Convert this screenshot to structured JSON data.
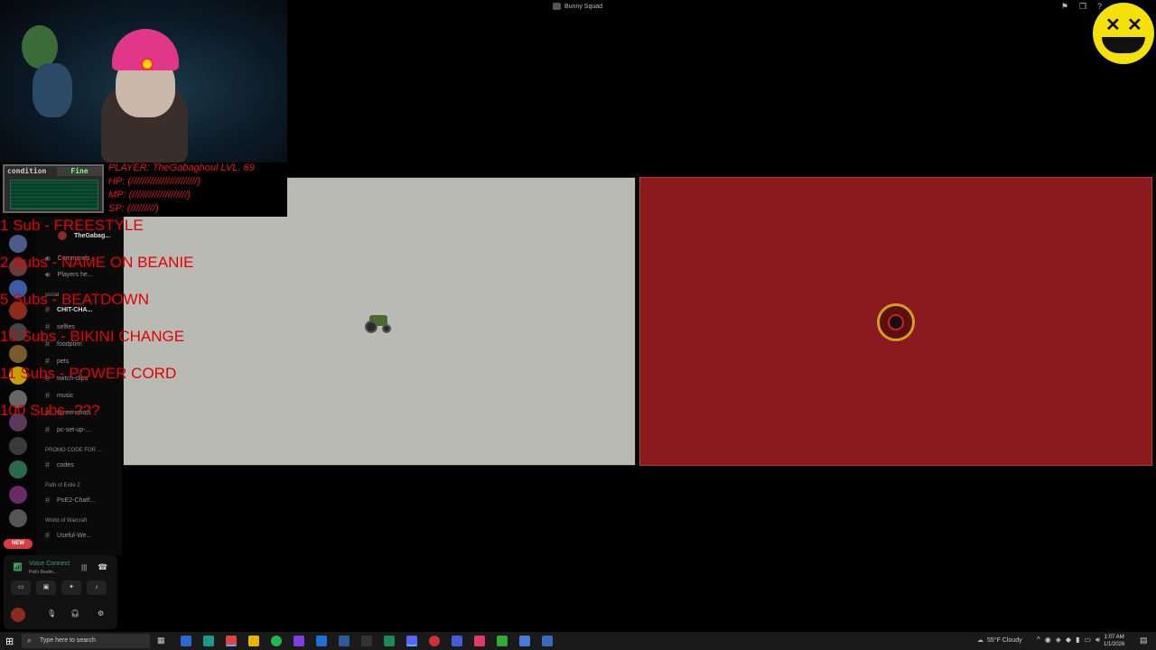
{
  "window": {
    "title": "Bunny Squad"
  },
  "title_icons": [
    "flag-icon",
    "restore-icon",
    "help-icon"
  ],
  "overlay": {
    "condition_label": "condition",
    "condition_value": "Fine",
    "player": "PLAYER: TheGabaghoul LVL. 69",
    "hp": "HP:    (////////////////////////)",
    "mp": "MP:    (////////////////////)",
    "sp": "SP: (/////////)"
  },
  "sub_goals": [
    "1 Sub - FREESTYLE",
    "2 Subs - NAME ON BEANIE",
    "5 Subs - BEATDOWN",
    "10 Subs - BIKINI CHANGE",
    "11 Subs - POWER CORD",
    "100 Subs -???"
  ],
  "channels": {
    "user_in_voice": "TheGabag...",
    "items": [
      {
        "label": "Commands",
        "icon": "speaker-icon"
      },
      {
        "label": "Players he...",
        "icon": "speaker-icon"
      },
      {
        "label": "CHIT-CHA...",
        "icon": "hash-icon"
      },
      {
        "label": "selfies",
        "icon": "hash-icon"
      },
      {
        "label": "foodporn",
        "icon": "hash-icon"
      },
      {
        "label": "pets",
        "icon": "hash-icon"
      },
      {
        "label": "twitch-clips",
        "icon": "hash-icon"
      },
      {
        "label": "music",
        "icon": "hash-icon"
      },
      {
        "label": "screenshots",
        "icon": "hash-icon"
      },
      {
        "label": "pc-set-up-...",
        "icon": "hash-icon"
      },
      {
        "label": "codes",
        "icon": "hash-icon"
      },
      {
        "label": "PoE2-Chatf...",
        "icon": "hash-icon"
      },
      {
        "label": "Useful-We...",
        "icon": "hash-icon"
      }
    ],
    "categories": {
      "social": "social",
      "promo": "PROMO CODE FOR ...",
      "poe": "Path of Exile 2",
      "wow": "World of Warcraft"
    }
  },
  "server_rail": {
    "new_badge": "NEW"
  },
  "user_panel": {
    "voice_title": "Voice Connect",
    "voice_sub": "Pollo Realm..."
  },
  "taskbar": {
    "search_placeholder": "Type here to search",
    "weather": "55°F  Cloudy",
    "time": "1:07 AM",
    "date": "1/1/2026"
  },
  "colors": {
    "goal_text": "#e60000",
    "tile_gray": "#b9bab3",
    "tile_red": "#8a1a1d",
    "voice_green": "#3ba55d",
    "logo_yellow": "#f5e10a"
  }
}
